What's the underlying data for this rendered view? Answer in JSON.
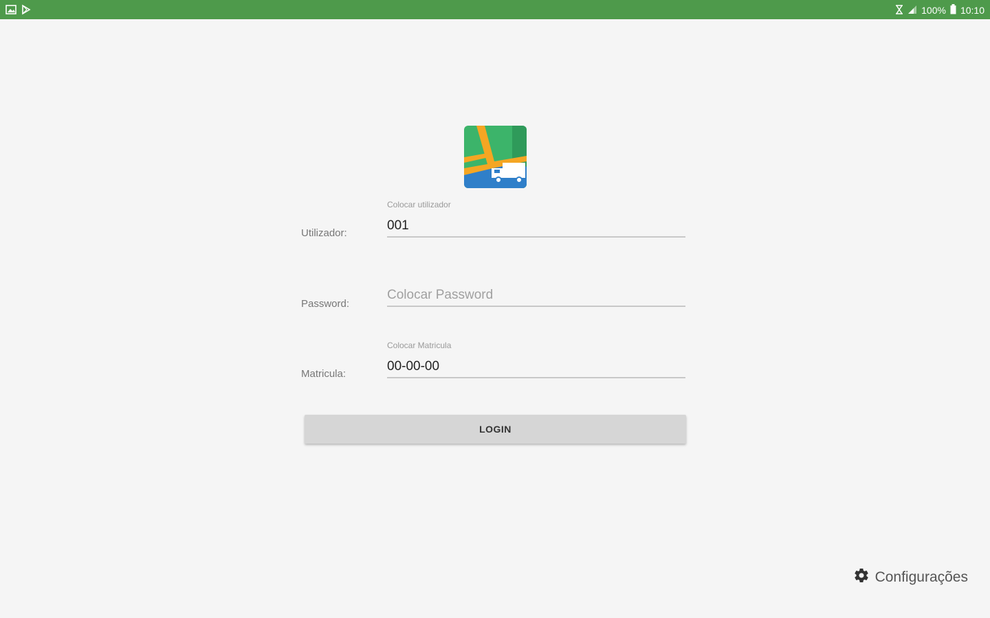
{
  "status_bar": {
    "left_icons": [
      "gallery-icon",
      "play-store-icon"
    ],
    "battery_text": "100%",
    "time": "10:10",
    "color": "#4e9a4b"
  },
  "login_form": {
    "user": {
      "label": "Utilizador:",
      "float_label": "Colocar utilizador",
      "value": "001"
    },
    "password": {
      "label": "Password:",
      "placeholder": "Colocar Password",
      "value": ""
    },
    "plate": {
      "label": "Matricula:",
      "float_label": "Colocar Matricula",
      "value": "00-00-00"
    },
    "login_label": "LOGIN"
  },
  "settings": {
    "label": "Configurações"
  }
}
